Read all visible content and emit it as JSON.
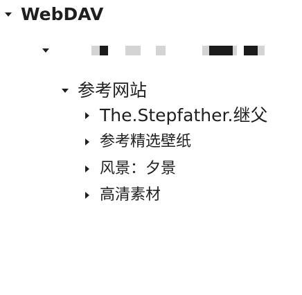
{
  "tree": {
    "root": {
      "label": "WebDAV",
      "expanded": true
    },
    "level1": {
      "expanded": true,
      "label_obscured": true
    },
    "folder": {
      "label": "参考网站",
      "expanded": true
    },
    "children": [
      {
        "label": "The.Stepfather.继父",
        "expanded": false
      },
      {
        "label": "参考精选壁纸",
        "expanded": false
      },
      {
        "label": "风景：夕景",
        "expanded": false
      },
      {
        "label": "高清素材",
        "expanded": false
      }
    ]
  },
  "icons": {
    "expanded": "chevron-down-icon",
    "collapsed": "chevron-right-icon"
  },
  "colors": {
    "text": "#1f1f1f",
    "background": "#ffffff",
    "redacted_dark": "#1b1b1b",
    "redacted_light": "#d4d4d4"
  }
}
